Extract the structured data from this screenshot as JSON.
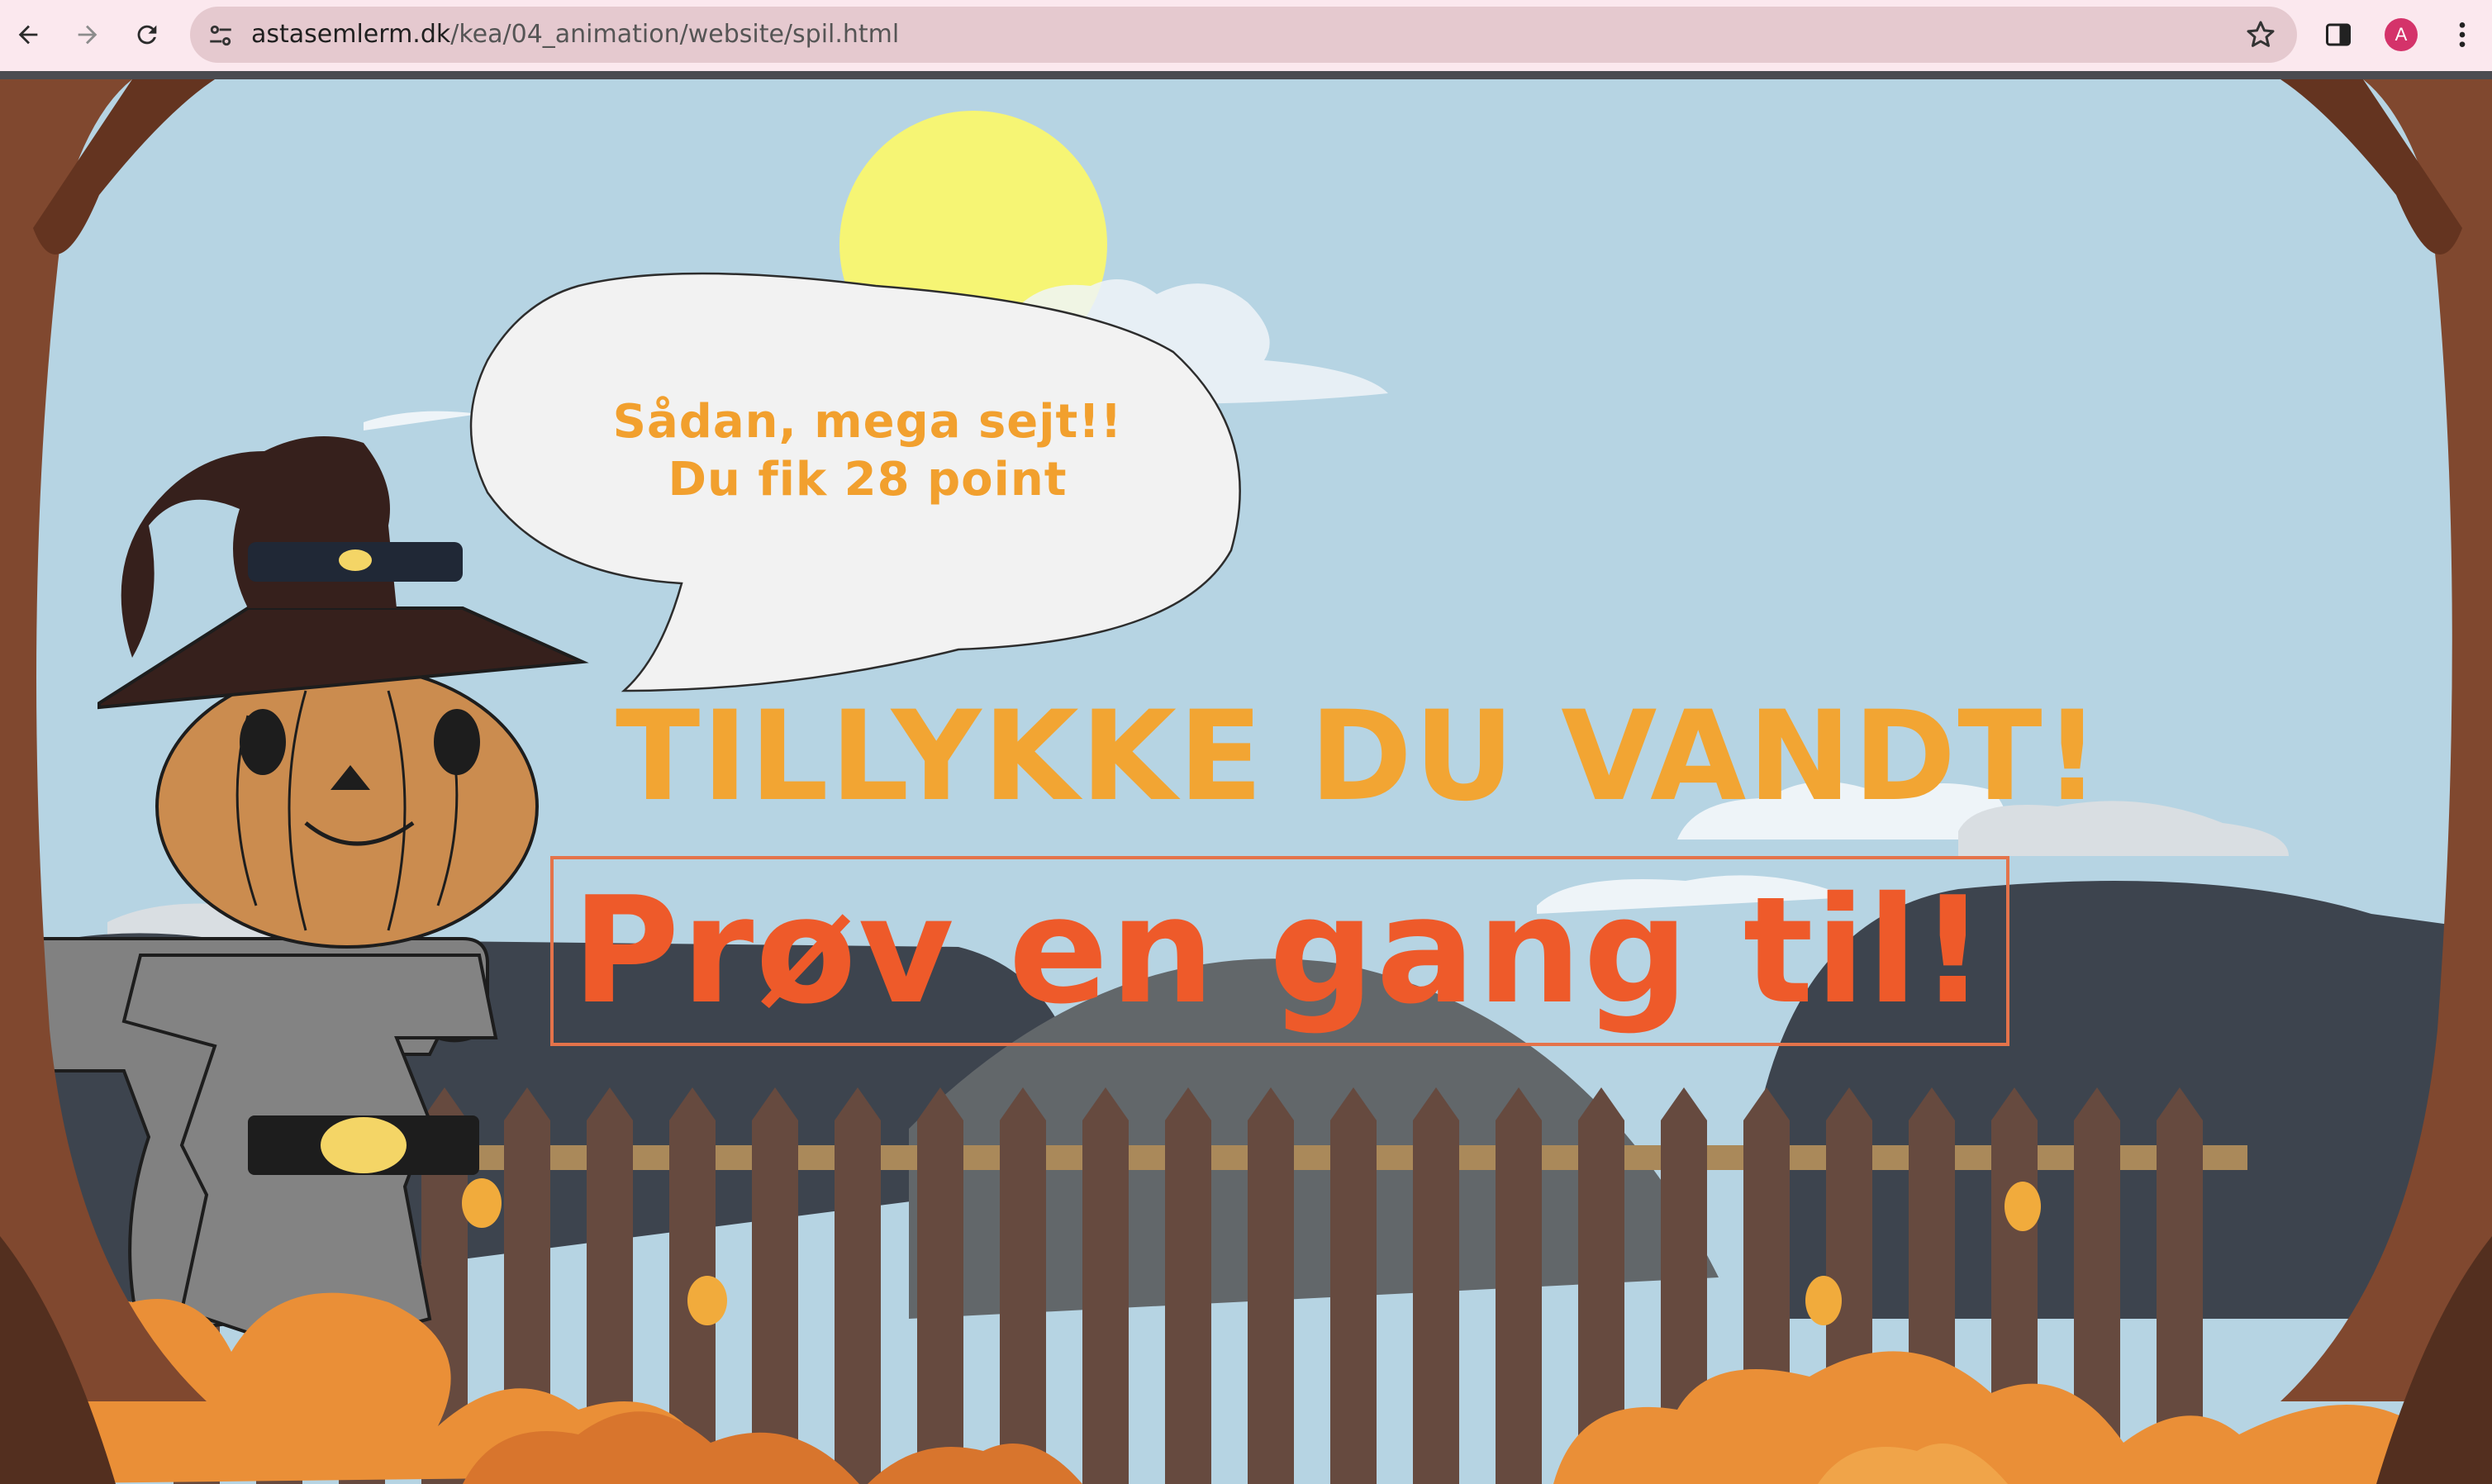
{
  "browser": {
    "url_host": "astasemlerm.dk",
    "url_path": "/kea/04_animation/website/spil.html",
    "profile_initial": "A",
    "icons": [
      "back-icon",
      "forward-icon",
      "reload-icon",
      "site-info-icon",
      "bookmark-star-icon",
      "side-panel-icon",
      "menu-icon"
    ]
  },
  "game": {
    "speech_line1": "Sådan, mega sejt!!",
    "speech_line2": "Du fik 28 point",
    "title": "TILLYKKE DU VANDT!",
    "retry_label": "Prøv en gang til!"
  },
  "colors": {
    "sky": "#b3d2e2",
    "title_orange": "#f2a533",
    "retry_red": "#ee5a2a",
    "sun": "#f6f56d",
    "pumpkin": "#c98646",
    "fence": "#5e4135"
  }
}
